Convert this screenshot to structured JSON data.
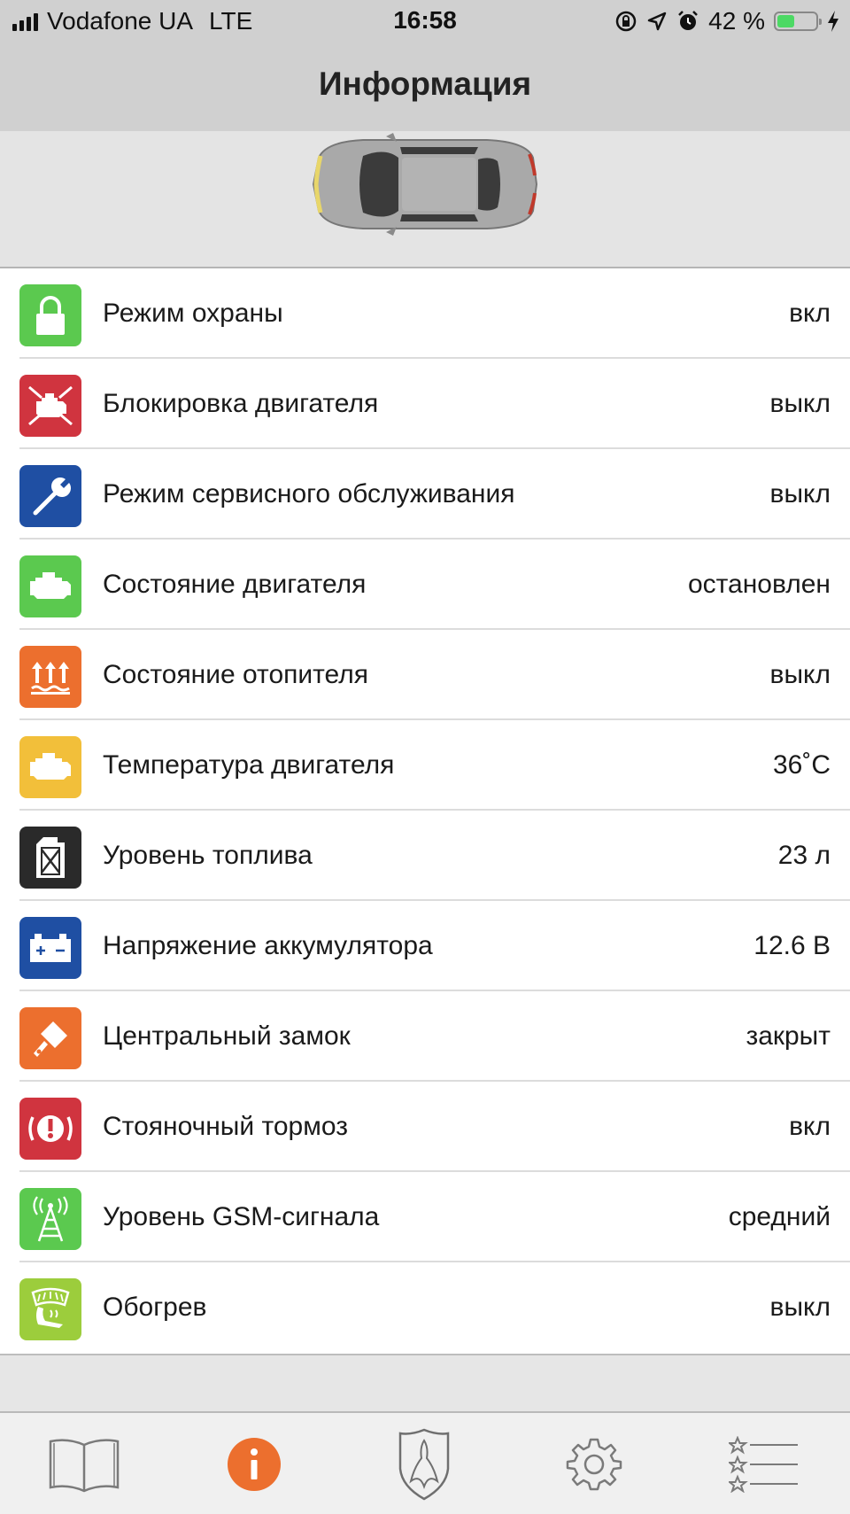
{
  "status": {
    "carrier": "Vodafone UA",
    "network": "LTE",
    "time": "16:58",
    "battery_percent": "42 %"
  },
  "header": {
    "title": "Информация"
  },
  "rows": [
    {
      "label": "Режим охраны",
      "value": "вкл",
      "icon": "lock-icon",
      "color": "#5bc94f"
    },
    {
      "label": "Блокировка двигателя",
      "value": "выкл",
      "icon": "engine-block-icon",
      "color": "#d0343f"
    },
    {
      "label": "Режим сервисного обслуживания",
      "value": "выкл",
      "icon": "wrench-icon",
      "color": "#1f4fa3"
    },
    {
      "label": "Состояние двигателя",
      "value": "остановлен",
      "icon": "engine-icon",
      "color": "#5bc94f"
    },
    {
      "label": "Состояние отопителя",
      "value": "выкл",
      "icon": "heater-icon",
      "color": "#ec6f2e"
    },
    {
      "label": "Температура двигателя",
      "value": "36˚С",
      "icon": "engine-temp-icon",
      "color": "#f2bf3a"
    },
    {
      "label": "Уровень топлива",
      "value": "23 л",
      "icon": "fuel-can-icon",
      "color": "#2a2a2a"
    },
    {
      "label": "Напряжение аккумулятора",
      "value": "12.6 В",
      "icon": "battery-icon",
      "color": "#1f4fa3"
    },
    {
      "label": "Центральный замок",
      "value": "закрыт",
      "icon": "key-icon",
      "color": "#ec6f2e"
    },
    {
      "label": "Стояночный тормоз",
      "value": "вкл",
      "icon": "parking-brake-icon",
      "color": "#d0343f"
    },
    {
      "label": "Уровень GSM-сигнала",
      "value": "средний",
      "icon": "antenna-icon",
      "color": "#5bc94f"
    },
    {
      "label": "Обогрев",
      "value": "выкл",
      "icon": "seat-heat-icon",
      "color": "#9ccd3c"
    }
  ],
  "tabs": [
    {
      "name": "book-icon",
      "active": false
    },
    {
      "name": "info-icon",
      "active": true,
      "accent": "#ec6f2e"
    },
    {
      "name": "shield-logo-icon",
      "active": false
    },
    {
      "name": "gear-icon",
      "active": false
    },
    {
      "name": "starred-list-icon",
      "active": false
    }
  ]
}
